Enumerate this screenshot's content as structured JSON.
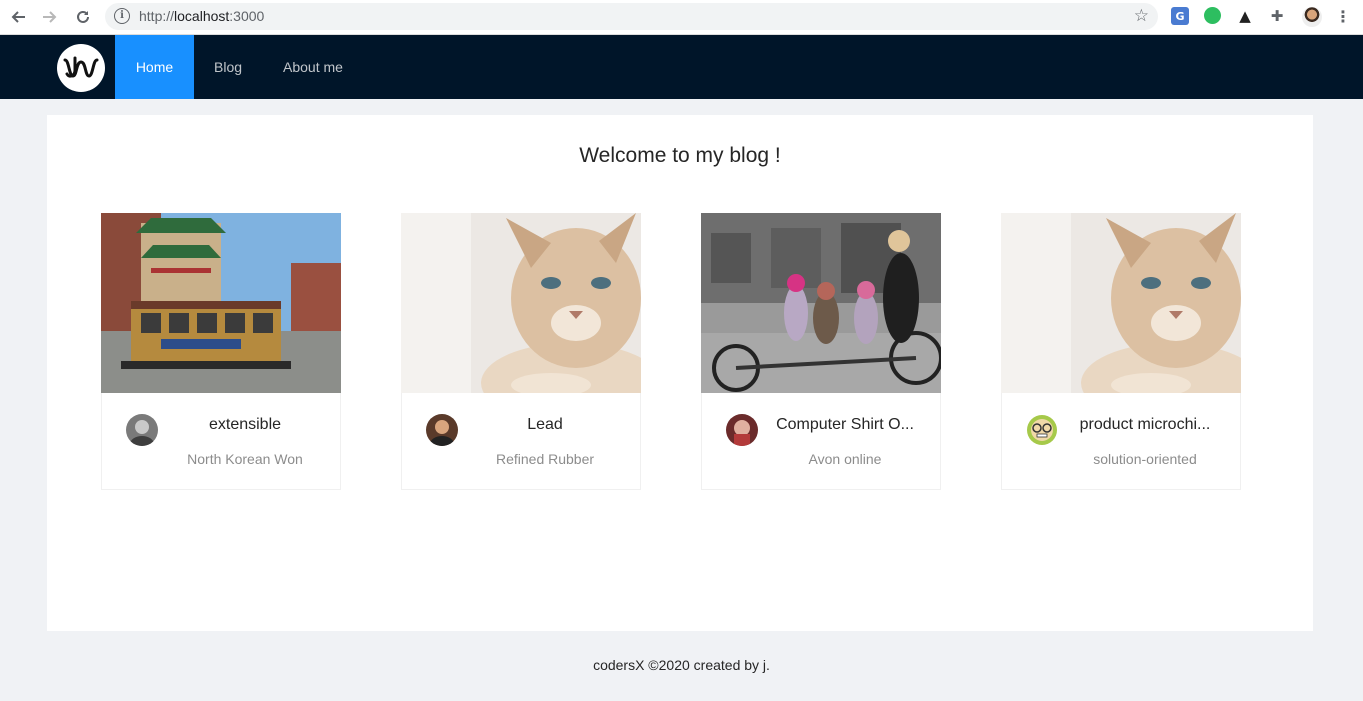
{
  "browser": {
    "url_scheme": "http://",
    "url_host": "localhost",
    "url_port": ":3000",
    "extensions": [
      "translate-icon",
      "evernote-icon",
      "bird-icon",
      "puzzle-icon",
      "profile-avatar",
      "kebab-menu-icon"
    ]
  },
  "header": {
    "menu": [
      {
        "label": "Home",
        "active": true
      },
      {
        "label": "Blog",
        "active": false
      },
      {
        "label": "About me",
        "active": false
      }
    ],
    "colors": {
      "background": "#001529",
      "active": "#1890ff"
    }
  },
  "main": {
    "title": "Welcome to my blog !",
    "cards": [
      {
        "title": "extensible",
        "description": "North Korean Won",
        "cover": "cable-car-chinatown-photo",
        "avatar": "grey-portrait"
      },
      {
        "title": "Lead",
        "description": "Refined Rubber",
        "cover": "siamese-cat-photo",
        "avatar": "dark-portrait"
      },
      {
        "title": "Computer Shirt O...",
        "description": "Avon online",
        "cover": "tandem-bicycle-kids-photo",
        "avatar": "red-portrait"
      },
      {
        "title": "product microchi...",
        "description": "solution-oriented",
        "cover": "siamese-cat-photo",
        "avatar": "cartoon-glasses-avatar"
      }
    ]
  },
  "footer": {
    "text": "codersX ©2020 created by j."
  }
}
